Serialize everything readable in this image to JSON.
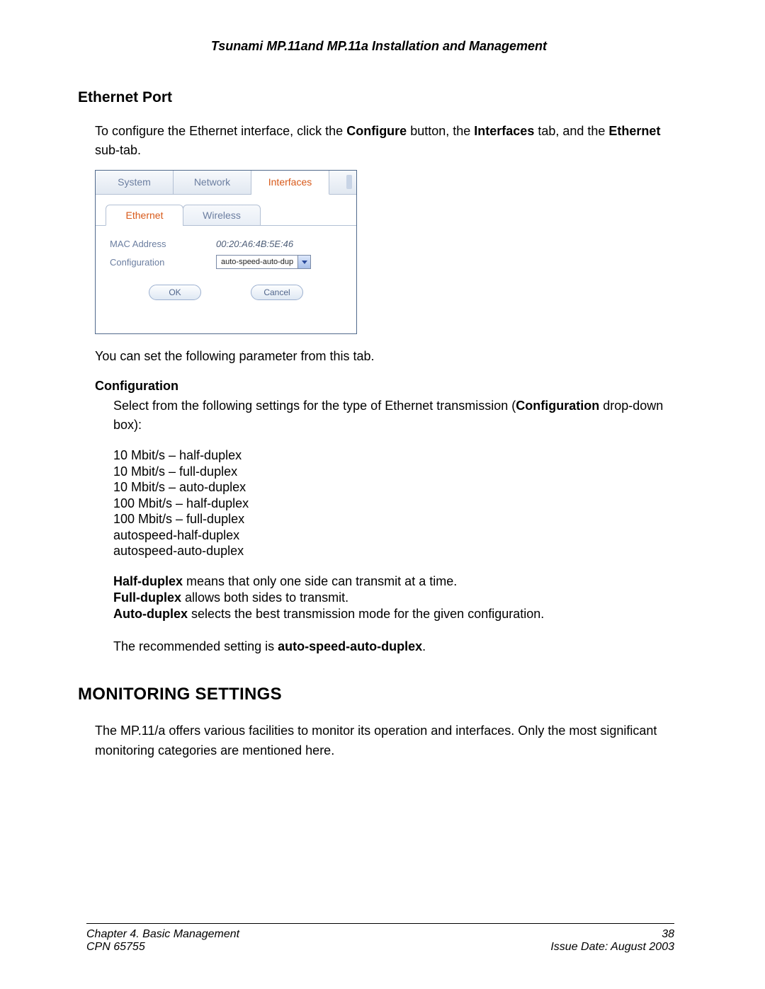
{
  "header": {
    "title": "Tsunami MP.11and MP.11a Installation and Management"
  },
  "section_ethernet": {
    "heading": "Ethernet Port",
    "intro_pre": "To configure the Ethernet interface, click the ",
    "intro_b1": "Configure",
    "intro_mid1": " button, the ",
    "intro_b2": "Interfaces",
    "intro_mid2": " tab, and the ",
    "intro_b3": "Ethernet",
    "intro_post": " sub-tab.",
    "after_img": "You can set the following parameter from this tab.",
    "config_heading": "Configuration",
    "config_body_pre": "Select from the following settings for the type of Ethernet transmission (",
    "config_body_b": "Configuration",
    "config_body_post": " drop-down box):",
    "options": [
      "10 Mbit/s – half-duplex",
      "10 Mbit/s – full-duplex",
      "10 Mbit/s – auto-duplex",
      "100 Mbit/s – half-duplex",
      "100 Mbit/s – full-duplex",
      "autospeed-half-duplex",
      "autospeed-auto-duplex"
    ],
    "def_half_b": "Half-duplex",
    "def_half": " means that only one side can transmit at a time.",
    "def_full_b": "Full-duplex",
    "def_full": " allows both sides to transmit.",
    "def_auto_b": "Auto-duplex",
    "def_auto": " selects the best transmission mode for the given configuration.",
    "rec_pre": "The recommended setting is ",
    "rec_b": "auto-speed-auto-duplex",
    "rec_post": "."
  },
  "ui_panel": {
    "tabs1": {
      "system": "System",
      "network": "Network",
      "interfaces": "Interfaces"
    },
    "tabs2": {
      "ethernet": "Ethernet",
      "wireless": "Wireless"
    },
    "mac_label": "MAC Address",
    "mac_value": "00:20:A6:4B:5E:46",
    "config_label": "Configuration",
    "config_value": "auto-speed-auto-dup",
    "ok": "OK",
    "cancel": "Cancel"
  },
  "section_monitoring": {
    "heading": "MONITORING SETTINGS",
    "body": "The MP.11/a offers various facilities to monitor its operation and interfaces.  Only the most significant monitoring categories are mentioned here."
  },
  "footer": {
    "chapter": "Chapter 4.  Basic Management",
    "page": "38",
    "cpn": "CPN 65755",
    "issue": "Issue Date:  August 2003"
  }
}
